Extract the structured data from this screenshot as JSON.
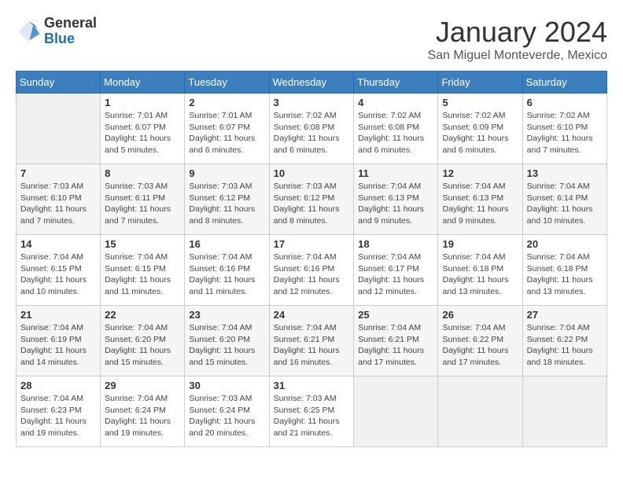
{
  "header": {
    "logo_general": "General",
    "logo_blue": "Blue",
    "month_title": "January 2024",
    "subtitle": "San Miguel Monteverde, Mexico"
  },
  "weekdays": [
    "Sunday",
    "Monday",
    "Tuesday",
    "Wednesday",
    "Thursday",
    "Friday",
    "Saturday"
  ],
  "weeks": [
    [
      {
        "day": "",
        "info": ""
      },
      {
        "day": "1",
        "info": "Sunrise: 7:01 AM\nSunset: 6:07 PM\nDaylight: 11 hours\nand 5 minutes."
      },
      {
        "day": "2",
        "info": "Sunrise: 7:01 AM\nSunset: 6:07 PM\nDaylight: 11 hours\nand 6 minutes."
      },
      {
        "day": "3",
        "info": "Sunrise: 7:02 AM\nSunset: 6:08 PM\nDaylight: 11 hours\nand 6 minutes."
      },
      {
        "day": "4",
        "info": "Sunrise: 7:02 AM\nSunset: 6:08 PM\nDaylight: 11 hours\nand 6 minutes."
      },
      {
        "day": "5",
        "info": "Sunrise: 7:02 AM\nSunset: 6:09 PM\nDaylight: 11 hours\nand 6 minutes."
      },
      {
        "day": "6",
        "info": "Sunrise: 7:02 AM\nSunset: 6:10 PM\nDaylight: 11 hours\nand 7 minutes."
      }
    ],
    [
      {
        "day": "7",
        "info": "Sunrise: 7:03 AM\nSunset: 6:10 PM\nDaylight: 11 hours\nand 7 minutes."
      },
      {
        "day": "8",
        "info": "Sunrise: 7:03 AM\nSunset: 6:11 PM\nDaylight: 11 hours\nand 7 minutes."
      },
      {
        "day": "9",
        "info": "Sunrise: 7:03 AM\nSunset: 6:12 PM\nDaylight: 11 hours\nand 8 minutes."
      },
      {
        "day": "10",
        "info": "Sunrise: 7:03 AM\nSunset: 6:12 PM\nDaylight: 11 hours\nand 8 minutes."
      },
      {
        "day": "11",
        "info": "Sunrise: 7:04 AM\nSunset: 6:13 PM\nDaylight: 11 hours\nand 9 minutes."
      },
      {
        "day": "12",
        "info": "Sunrise: 7:04 AM\nSunset: 6:13 PM\nDaylight: 11 hours\nand 9 minutes."
      },
      {
        "day": "13",
        "info": "Sunrise: 7:04 AM\nSunset: 6:14 PM\nDaylight: 11 hours\nand 10 minutes."
      }
    ],
    [
      {
        "day": "14",
        "info": "Sunrise: 7:04 AM\nSunset: 6:15 PM\nDaylight: 11 hours\nand 10 minutes."
      },
      {
        "day": "15",
        "info": "Sunrise: 7:04 AM\nSunset: 6:15 PM\nDaylight: 11 hours\nand 11 minutes."
      },
      {
        "day": "16",
        "info": "Sunrise: 7:04 AM\nSunset: 6:16 PM\nDaylight: 11 hours\nand 11 minutes."
      },
      {
        "day": "17",
        "info": "Sunrise: 7:04 AM\nSunset: 6:16 PM\nDaylight: 11 hours\nand 12 minutes."
      },
      {
        "day": "18",
        "info": "Sunrise: 7:04 AM\nSunset: 6:17 PM\nDaylight: 11 hours\nand 12 minutes."
      },
      {
        "day": "19",
        "info": "Sunrise: 7:04 AM\nSunset: 6:18 PM\nDaylight: 11 hours\nand 13 minutes."
      },
      {
        "day": "20",
        "info": "Sunrise: 7:04 AM\nSunset: 6:18 PM\nDaylight: 11 hours\nand 13 minutes."
      }
    ],
    [
      {
        "day": "21",
        "info": "Sunrise: 7:04 AM\nSunset: 6:19 PM\nDaylight: 11 hours\nand 14 minutes."
      },
      {
        "day": "22",
        "info": "Sunrise: 7:04 AM\nSunset: 6:20 PM\nDaylight: 11 hours\nand 15 minutes."
      },
      {
        "day": "23",
        "info": "Sunrise: 7:04 AM\nSunset: 6:20 PM\nDaylight: 11 hours\nand 15 minutes."
      },
      {
        "day": "24",
        "info": "Sunrise: 7:04 AM\nSunset: 6:21 PM\nDaylight: 11 hours\nand 16 minutes."
      },
      {
        "day": "25",
        "info": "Sunrise: 7:04 AM\nSunset: 6:21 PM\nDaylight: 11 hours\nand 17 minutes."
      },
      {
        "day": "26",
        "info": "Sunrise: 7:04 AM\nSunset: 6:22 PM\nDaylight: 11 hours\nand 17 minutes."
      },
      {
        "day": "27",
        "info": "Sunrise: 7:04 AM\nSunset: 6:22 PM\nDaylight: 11 hours\nand 18 minutes."
      }
    ],
    [
      {
        "day": "28",
        "info": "Sunrise: 7:04 AM\nSunset: 6:23 PM\nDaylight: 11 hours\nand 19 minutes."
      },
      {
        "day": "29",
        "info": "Sunrise: 7:04 AM\nSunset: 6:24 PM\nDaylight: 11 hours\nand 19 minutes."
      },
      {
        "day": "30",
        "info": "Sunrise: 7:03 AM\nSunset: 6:24 PM\nDaylight: 11 hours\nand 20 minutes."
      },
      {
        "day": "31",
        "info": "Sunrise: 7:03 AM\nSunset: 6:25 PM\nDaylight: 11 hours\nand 21 minutes."
      },
      {
        "day": "",
        "info": ""
      },
      {
        "day": "",
        "info": ""
      },
      {
        "day": "",
        "info": ""
      }
    ]
  ]
}
